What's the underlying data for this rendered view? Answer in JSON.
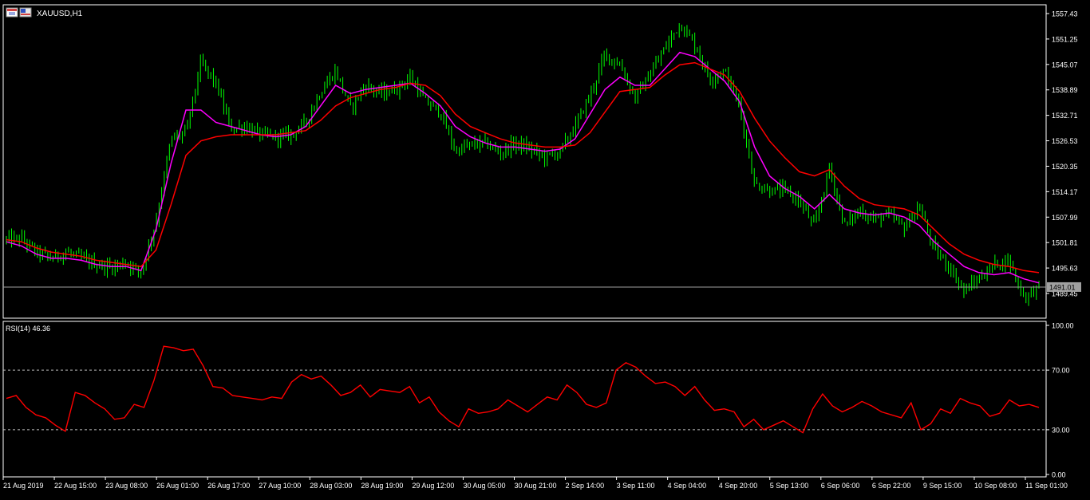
{
  "chart_header": {
    "symbol_label": "XAUUSD,H1",
    "icon": "window-icon"
  },
  "colors": {
    "background": "#000000",
    "frame": "#ffffff",
    "candle": "#00ff00",
    "ma_fast": "#ff00ff",
    "ma_slow": "#ff0000",
    "rsi_line": "#ff0000",
    "bid_line": "#a0a0a0",
    "price_label_bg": "#a0a0a0"
  },
  "current_price_label": "1491.01",
  "rsi_label": "RSI(14) 46.36",
  "chart_data": [
    {
      "type": "candlestick",
      "symbol": "XAUUSD",
      "timeframe": "H1",
      "y_ticks": [
        "1557.43",
        "1551.25",
        "1545.07",
        "1538.89",
        "1532.71",
        "1526.53",
        "1520.35",
        "1514.17",
        "1507.99",
        "1501.81",
        "1495.63",
        "1489.45"
      ],
      "ylim": [
        1484.5,
        1559.5
      ],
      "current_price": 1491.01,
      "x_ticks": [
        "21 Aug 2019",
        "22 Aug 15:00",
        "23 Aug 08:00",
        "26 Aug 01:00",
        "26 Aug 17:00",
        "27 Aug 10:00",
        "28 Aug 03:00",
        "28 Aug 19:00",
        "29 Aug 12:00",
        "30 Aug 05:00",
        "30 Aug 21:00",
        "2 Sep 14:00",
        "3 Sep 11:00",
        "4 Sep 04:00",
        "4 Sep 20:00",
        "5 Sep 13:00",
        "6 Sep 06:00",
        "6 Sep 22:00",
        "9 Sep 15:00",
        "10 Sep 08:00",
        "11 Sep 01:00"
      ],
      "approx_price_path": [
        1502.5,
        1502.8,
        1499.5,
        1498.0,
        1499.5,
        1498.0,
        1496.5,
        1495.8,
        1497.0,
        1494.5,
        1507.0,
        1527.0,
        1528.5,
        1545.5,
        1540.5,
        1529.5,
        1530.0,
        1528.0,
        1527.5,
        1528.0,
        1531.0,
        1538.5,
        1543.5,
        1534.5,
        1540.0,
        1538.0,
        1539.0,
        1542.0,
        1536.0,
        1533.5,
        1524.0,
        1525.5,
        1526.0,
        1523.5,
        1526.0,
        1524.5,
        1522.5,
        1524.0,
        1530.0,
        1537.5,
        1547.5,
        1545.0,
        1537.0,
        1542.5,
        1549.0,
        1555.0,
        1550.0,
        1541.5,
        1543.5,
        1535.0,
        1516.0,
        1514.5,
        1514.5,
        1512.0,
        1505.5,
        1520.0,
        1506.0,
        1509.5,
        1507.5,
        1508.5,
        1505.5,
        1510.5,
        1500.0,
        1496.0,
        1490.0,
        1493.0,
        1496.5,
        1497.5,
        1488.5,
        1491.0
      ],
      "series": [
        {
          "name": "MA fast",
          "values": [
            1502.0,
            1501.0,
            1499.0,
            1498.0,
            1498.0,
            1497.5,
            1496.5,
            1496.0,
            1496.0,
            1495.0,
            1505.0,
            1521.0,
            1534.0,
            1534.0,
            1531.0,
            1530.0,
            1529.0,
            1528.0,
            1527.5,
            1528.0,
            1530.0,
            1535.0,
            1540.0,
            1538.0,
            1539.0,
            1539.5,
            1540.0,
            1540.5,
            1538.0,
            1535.0,
            1530.0,
            1527.5,
            1526.0,
            1525.0,
            1525.0,
            1524.5,
            1524.0,
            1524.5,
            1527.0,
            1533.0,
            1539.0,
            1542.0,
            1540.0,
            1540.0,
            1544.0,
            1548.0,
            1547.0,
            1544.0,
            1541.0,
            1536.0,
            1525.0,
            1518.0,
            1515.0,
            1513.0,
            1510.0,
            1513.5,
            1510.0,
            1509.0,
            1508.5,
            1509.0,
            1508.0,
            1506.0,
            1502.0,
            1499.0,
            1496.0,
            1494.5,
            1494.0,
            1494.5,
            1493.0,
            1492.0
          ]
        },
        {
          "name": "MA slow",
          "values": [
            1502.5,
            1502.0,
            1500.5,
            1499.5,
            1499.0,
            1498.5,
            1497.5,
            1497.0,
            1496.5,
            1496.0,
            1500.0,
            1511.0,
            1523.0,
            1526.5,
            1527.5,
            1528.0,
            1528.0,
            1528.0,
            1528.0,
            1528.5,
            1529.0,
            1531.5,
            1535.0,
            1537.0,
            1538.0,
            1539.0,
            1539.5,
            1540.5,
            1540.0,
            1537.5,
            1533.0,
            1530.0,
            1528.5,
            1527.0,
            1526.0,
            1525.5,
            1525.0,
            1525.0,
            1525.5,
            1528.5,
            1533.5,
            1538.5,
            1539.0,
            1539.5,
            1542.5,
            1545.0,
            1545.5,
            1544.0,
            1542.5,
            1538.5,
            1532.0,
            1526.5,
            1522.5,
            1519.0,
            1518.0,
            1519.5,
            1515.5,
            1512.5,
            1511.0,
            1510.5,
            1510.0,
            1508.5,
            1505.0,
            1501.5,
            1499.0,
            1497.5,
            1496.5,
            1496.0,
            1495.0,
            1494.5
          ]
        }
      ]
    },
    {
      "type": "line",
      "name": "RSI(14)",
      "last_value": 46.36,
      "y_ticks": [
        "100.00",
        "70.00",
        "30.00",
        "0.00"
      ],
      "ylim": [
        0,
        100
      ],
      "reference_lines": [
        70,
        30
      ],
      "series": [
        {
          "name": "RSI(14)",
          "values": [
            51,
            53,
            45,
            40,
            38,
            33,
            29,
            55,
            53,
            48,
            44,
            37,
            38,
            47,
            45,
            63,
            86,
            85,
            83,
            84,
            73,
            59,
            58,
            53,
            52,
            51,
            50,
            52,
            51,
            62,
            67,
            64,
            66,
            60,
            53,
            55,
            60,
            52,
            57,
            56,
            55,
            59,
            48,
            52,
            42,
            36,
            32,
            44,
            41,
            42,
            44,
            50,
            46,
            42,
            47,
            52,
            50,
            60,
            55,
            47,
            45,
            48,
            70,
            75,
            72,
            66,
            61,
            62,
            59,
            53,
            59,
            50,
            43,
            44,
            42,
            32,
            37,
            30,
            33,
            36,
            32,
            28,
            44,
            54,
            46,
            42,
            45,
            49,
            46,
            42,
            40,
            38,
            48,
            30,
            34,
            44,
            41,
            51,
            48,
            46,
            39,
            41,
            50,
            46,
            47,
            45
          ]
        }
      ]
    }
  ]
}
